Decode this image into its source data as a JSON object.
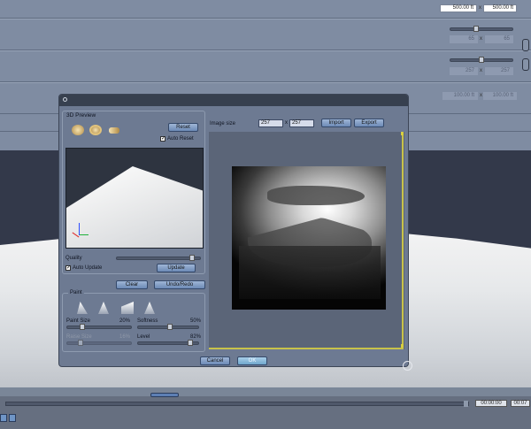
{
  "background_panel": {
    "row1": {
      "w": "500.00 ft",
      "sep": "x",
      "h": "500.00 ft"
    },
    "row2": {
      "a": "65",
      "sep": "x",
      "b": "65"
    },
    "row3": {
      "a": "257",
      "sep": "x",
      "b": "257"
    },
    "row4": {
      "a": "100.00 ft",
      "sep": "x",
      "b": "100.00 ft"
    }
  },
  "dialog": {
    "preview": {
      "title": "3D Preview",
      "reset_label": "Reset",
      "auto_reset_label": "Auto Reset",
      "quality_label": "Quality",
      "auto_update_label": "Auto Update",
      "update_label": "Update",
      "check_mark": "✓"
    },
    "clear_label": "Clear",
    "undo_redo_label": "Undo/Redo",
    "paint": {
      "title": "Paint",
      "paint_size_label": "Paint Size",
      "paint_size_value": "20%",
      "softness_label": "Softness",
      "softness_value": "50%",
      "raise_size_label": "Raise Size",
      "raise_size_value": "16%",
      "level_label": "Level",
      "level_value": "82%"
    },
    "image": {
      "size_label": "Image size",
      "width": "257",
      "sep": "x",
      "height": "257",
      "import_label": "Import",
      "export_label": "Export"
    },
    "cancel_label": "Cancel",
    "ok_label": "OK"
  },
  "timeline": {
    "time_start": "00:00:00",
    "time_end": "00:07"
  }
}
